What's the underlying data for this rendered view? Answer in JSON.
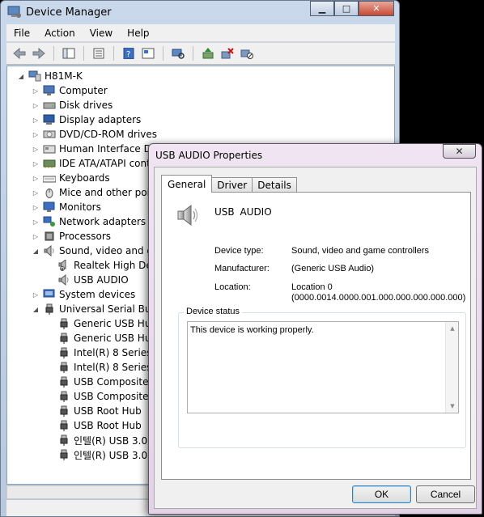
{
  "device_manager": {
    "title": "Device Manager",
    "menu": [
      "File",
      "Action",
      "View",
      "Help"
    ],
    "toolbar_icons": [
      "back-icon",
      "forward-icon",
      "show-hide-tree-icon",
      "properties-icon",
      "help-icon",
      "show-hidden-icon",
      "scan-hardware-icon",
      "update-driver-icon",
      "uninstall-icon",
      "disable-icon"
    ],
    "tree": [
      {
        "label": "H81M-K",
        "level": 0,
        "expander": "expanded",
        "icon": "computer-root"
      },
      {
        "label": "Computer",
        "level": 1,
        "expander": "collapsed",
        "icon": "computer"
      },
      {
        "label": "Disk drives",
        "level": 1,
        "expander": "collapsed",
        "icon": "disk"
      },
      {
        "label": "Display adapters",
        "level": 1,
        "expander": "collapsed",
        "icon": "display"
      },
      {
        "label": "DVD/CD-ROM drives",
        "level": 1,
        "expander": "collapsed",
        "icon": "dvd"
      },
      {
        "label": "Human Interface Dev",
        "level": 1,
        "expander": "collapsed",
        "icon": "hid"
      },
      {
        "label": "IDE ATA/ATAPI cont",
        "level": 1,
        "expander": "collapsed",
        "icon": "ide"
      },
      {
        "label": "Keyboards",
        "level": 1,
        "expander": "collapsed",
        "icon": "keyboard"
      },
      {
        "label": "Mice and other point",
        "level": 1,
        "expander": "collapsed",
        "icon": "mouse"
      },
      {
        "label": "Monitors",
        "level": 1,
        "expander": "collapsed",
        "icon": "monitor"
      },
      {
        "label": "Network adapters",
        "level": 1,
        "expander": "collapsed",
        "icon": "network"
      },
      {
        "label": "Processors",
        "level": 1,
        "expander": "collapsed",
        "icon": "cpu"
      },
      {
        "label": "Sound, video and ga",
        "level": 1,
        "expander": "expanded",
        "icon": "speaker"
      },
      {
        "label": "Realtek High Defi",
        "level": 2,
        "expander": "none",
        "icon": "speaker-warning"
      },
      {
        "label": "USB  AUDIO",
        "level": 2,
        "expander": "none",
        "icon": "speaker"
      },
      {
        "label": "System devices",
        "level": 1,
        "expander": "collapsed",
        "icon": "system"
      },
      {
        "label": "Universal Serial Bus c",
        "level": 1,
        "expander": "expanded",
        "icon": "usb"
      },
      {
        "label": "Generic USB Hub",
        "level": 2,
        "expander": "none",
        "icon": "usb"
      },
      {
        "label": "Generic USB Hub",
        "level": 2,
        "expander": "none",
        "icon": "usb"
      },
      {
        "label": "Intel(R) 8 Series/C",
        "level": 2,
        "expander": "none",
        "icon": "usb"
      },
      {
        "label": "Intel(R) 8 Series/C",
        "level": 2,
        "expander": "none",
        "icon": "usb"
      },
      {
        "label": "USB Composite D",
        "level": 2,
        "expander": "none",
        "icon": "usb"
      },
      {
        "label": "USB Composite D",
        "level": 2,
        "expander": "none",
        "icon": "usb"
      },
      {
        "label": "USB Root Hub",
        "level": 2,
        "expander": "none",
        "icon": "usb"
      },
      {
        "label": "USB Root Hub",
        "level": 2,
        "expander": "none",
        "icon": "usb"
      },
      {
        "label": "인텔(R) USB 3.0 ",
        "level": 2,
        "expander": "none",
        "icon": "usb"
      },
      {
        "label": "인텔(R) USB 3.0 ",
        "level": 2,
        "expander": "none",
        "icon": "usb"
      }
    ]
  },
  "dialog": {
    "title": "USB  AUDIO   Properties",
    "close_label": "✕",
    "tabs": [
      "General",
      "Driver",
      "Details"
    ],
    "device_name": "USB  AUDIO",
    "device_type_label": "Device type:",
    "device_type_value": "Sound, video and game controllers",
    "manufacturer_label": "Manufacturer:",
    "manufacturer_value": "(Generic USB Audio)",
    "location_label": "Location:",
    "location_value_1": "Location 0",
    "location_value_2": "(0000.0014.0000.001.000.000.000.000.000)",
    "status_group_label": "Device status",
    "status_text": "This device is working properly.",
    "ok_label": "OK",
    "cancel_label": "Cancel"
  }
}
